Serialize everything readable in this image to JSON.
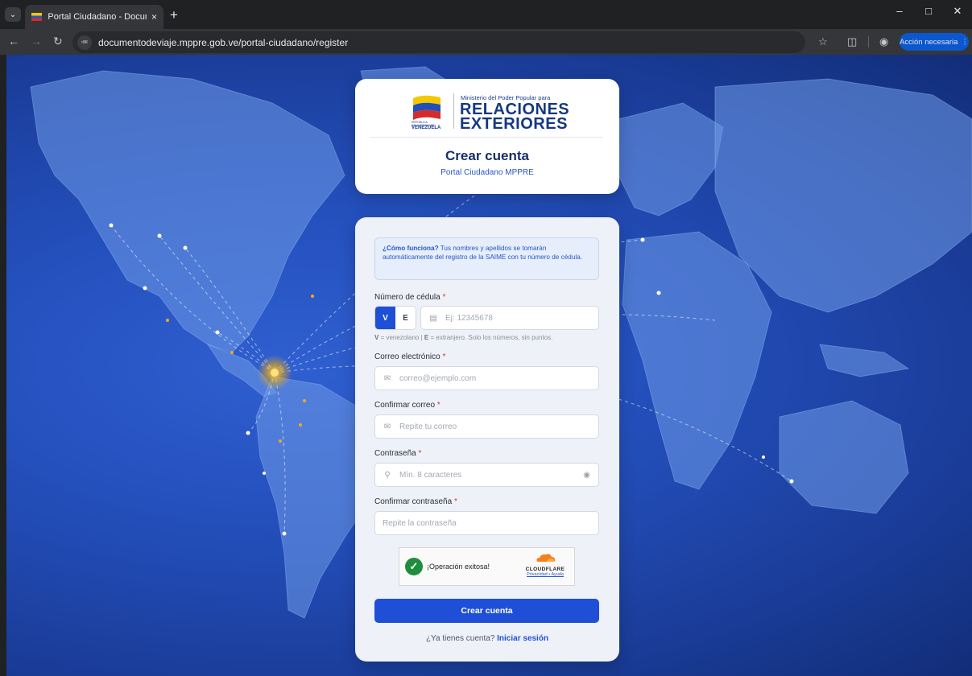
{
  "browser": {
    "tab_title": "Portal Ciudadano - Documento",
    "tab_close": "×",
    "new_tab": "+",
    "url": "documentodeviaje.mppre.gob.ve/portal-ciudadano/register",
    "action_label": "Acción necesaria",
    "accent": "#0b57d0"
  },
  "header_card": {
    "logo_ministry": "Ministerio del Poder Popular para",
    "logo_line1": "RELACIONES",
    "logo_line2": "EXTERIORES",
    "logo_country_small": "REPÚBLICA BOLIVARIANA DE",
    "logo_country": "VENEZUELA",
    "title": "Crear cuenta",
    "subtitle": "Portal Ciudadano MPPRE"
  },
  "form": {
    "info_strong": "¿Cómo funciona?",
    "info_text": " Tus nombres y apellidos se tomarán automáticamente del registro de la SAIME con tu número de cédula.",
    "cedula_label": "Número de cédula",
    "required_mark": "*",
    "toggle_v": "V",
    "toggle_e": "E",
    "cedula_placeholder": "Ej: 12345678",
    "help_v": "V",
    "help_v_text": " = venezolano",
    "help_sep": " | ",
    "help_e": "E",
    "help_e_text": " = extranjero. Solo los números, sin puntos.",
    "email_label": "Correo electrónico",
    "email_placeholder": "correo@ejemplo.com",
    "confirm_email_label": "Confirmar correo",
    "confirm_email_placeholder": "Repite tu correo",
    "password_label": "Contraseña",
    "password_placeholder": "Mín. 8 caracteres",
    "confirm_password_label": "Confirmar contraseña",
    "confirm_password_placeholder": "Repite la contraseña",
    "captcha_status": "¡Operación exitosa!",
    "captcha_brand": "CLOUDFLARE",
    "captcha_privacy": "Privacidad",
    "captcha_sep": " • ",
    "captcha_help": "Ayuda",
    "submit_label": "Crear cuenta",
    "login_prompt": "¿Ya tienes cuenta? ",
    "login_link": "Iniciar sesión",
    "primary_color": "#1f4fd6"
  }
}
